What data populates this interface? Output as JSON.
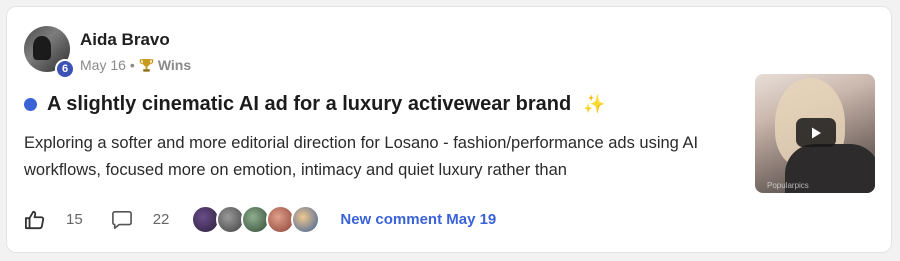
{
  "post": {
    "author": "Aida Bravo",
    "level": "6",
    "date": "May 16",
    "separator": "•",
    "category": "Wins",
    "title": "A slightly cinematic AI ad for a luxury activewear brand",
    "title_emoji": "✨",
    "excerpt": "Exploring a softer and more editorial direction for Losano - fashion/performance ads using AI workflows, focused more on emotion, intimacy and quiet luxury rather than",
    "thumbnail_watermark": "Popularpics"
  },
  "footer": {
    "likes": "15",
    "comments": "22",
    "new_comment": "New comment May 19"
  },
  "commenters": [
    {
      "color": "#3a2a4a"
    },
    {
      "color": "#6b6b6b"
    },
    {
      "color": "#4f6e55"
    },
    {
      "color": "#b56a5a"
    },
    {
      "color": "#4a6fa8"
    }
  ],
  "colors": {
    "accent": "#3b63d8",
    "level_badge": "#3c53b5"
  },
  "icons": [
    "trophy-icon",
    "thumbs-up-icon",
    "comment-icon",
    "play-icon"
  ]
}
